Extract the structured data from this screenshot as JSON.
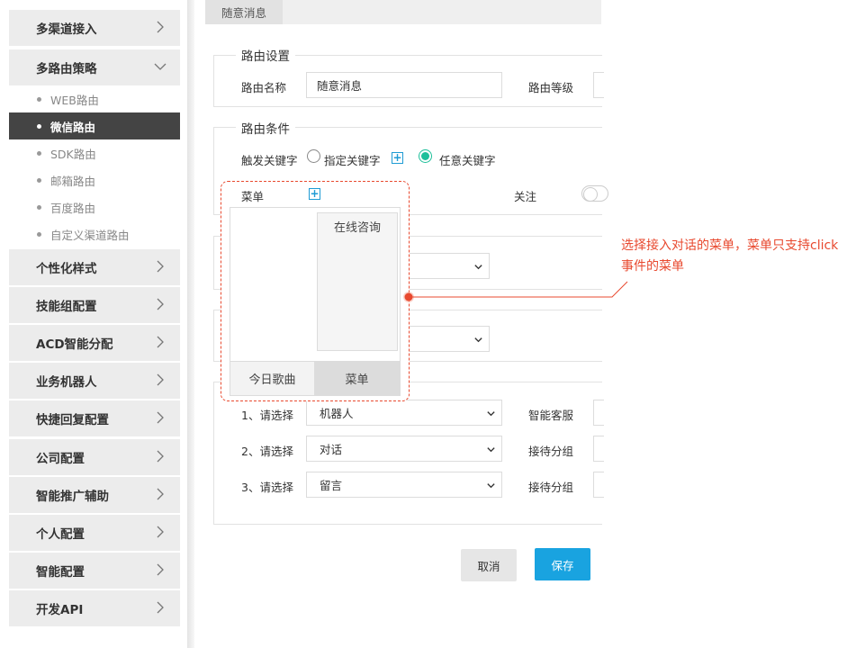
{
  "sidebar": {
    "groups_top": [
      {
        "label": "多渠道接入"
      },
      {
        "label": "多路由策略"
      }
    ],
    "sub_items": [
      {
        "label": "WEB路由"
      },
      {
        "label": "微信路由"
      },
      {
        "label": "SDK路由"
      },
      {
        "label": "邮箱路由"
      },
      {
        "label": "百度路由"
      },
      {
        "label": "自定义渠道路由"
      }
    ],
    "groups_bottom": [
      {
        "label": "个性化样式"
      },
      {
        "label": "技能组配置"
      },
      {
        "label": "ACD智能分配"
      },
      {
        "label": "业务机器人"
      },
      {
        "label": "快捷回复配置"
      },
      {
        "label": "公司配置"
      },
      {
        "label": "智能推广辅助"
      },
      {
        "label": "个人配置"
      },
      {
        "label": "智能配置"
      },
      {
        "label": "开发API"
      }
    ]
  },
  "tab": {
    "label": "随意消息"
  },
  "route_settings": {
    "legend": "路由设置",
    "name_label": "路由名称",
    "name_value": "随意消息",
    "level_label": "路由等级"
  },
  "route_conditions": {
    "legend": "路由条件",
    "trigger_label": "触发关键字",
    "option_specific": "指定关键字",
    "option_any": "任意关键字",
    "menu_label": "菜单",
    "follow_label": "关注"
  },
  "menu_preview": {
    "submenu_item": "在线咨询",
    "tab1": "今日歌曲",
    "tab2": "菜单"
  },
  "steps": [
    {
      "label": "1、请选择",
      "value": "机器人",
      "right_label": "智能客服"
    },
    {
      "label": "2、请选择",
      "value": "对话",
      "right_label": "接待分组"
    },
    {
      "label": "3、请选择",
      "value": "留言",
      "right_label": "接待分组"
    }
  ],
  "buttons": {
    "cancel": "取消",
    "save": "保存"
  },
  "annotation": {
    "text": "选择接入对话的菜单，菜单只支持click事件的菜单"
  },
  "colors": {
    "accent_blue": "#19a3e0",
    "radio_green": "#1dbf9a",
    "annotation_red": "#e8492f",
    "active_sidebar": "#444444"
  }
}
